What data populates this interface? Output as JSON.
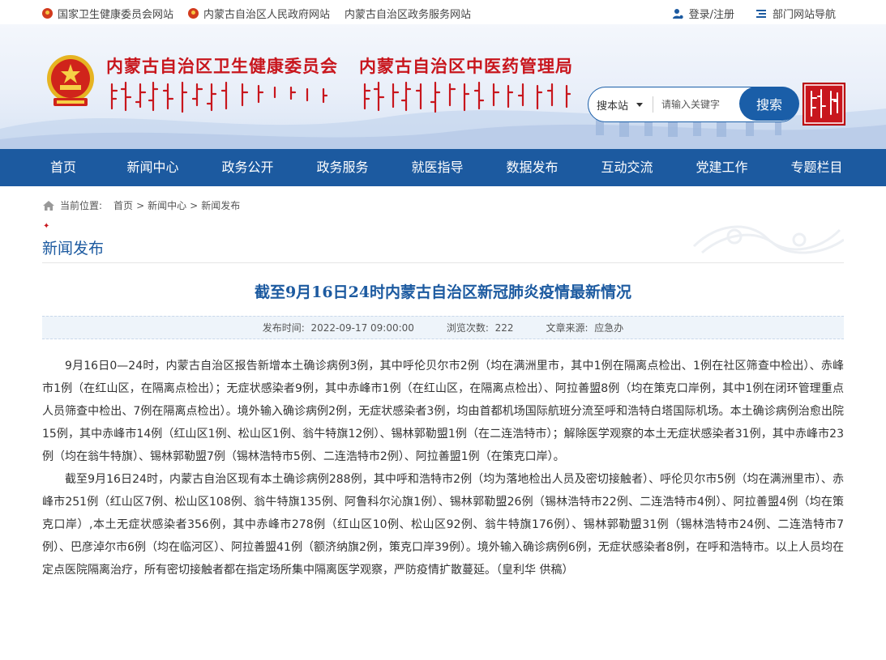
{
  "topbar": {
    "links": [
      "国家卫生健康委员会网站",
      "内蒙古自治区人民政府网站",
      "内蒙古自治区政务服务网站"
    ],
    "login": "登录/注册",
    "nav_guide": "部门网站导航"
  },
  "banner": {
    "title1": "内蒙古自治区卫生健康委员会",
    "title2": "内蒙古自治区中医药管理局",
    "search": {
      "scope": "搜本站",
      "placeholder": "请输入关键字",
      "button": "搜索"
    }
  },
  "nav": [
    "首页",
    "新闻中心",
    "政务公开",
    "政务服务",
    "就医指导",
    "数据发布",
    "互动交流",
    "党建工作",
    "专题栏目"
  ],
  "breadcrumb": {
    "prefix": "当前位置:",
    "items": [
      "首页",
      "新闻中心",
      "新闻发布"
    ],
    "sep": ">"
  },
  "section_title": "新闻发布",
  "article": {
    "title": "截至9月16日24时内蒙古自治区新冠肺炎疫情最新情况",
    "publish_label": "发布时间:",
    "publish_time": "2022-09-17 09:00:00",
    "views_label": "浏览次数:",
    "views": "222",
    "source_label": "文章来源:",
    "source": "应急办",
    "paragraphs": [
      "9月16日0—24时，内蒙古自治区报告新增本土确诊病例3例，其中呼伦贝尔市2例（均在满洲里市，其中1例在隔离点检出、1例在社区筛查中检出）、赤峰市1例（在红山区，在隔离点检出）；无症状感染者9例，其中赤峰市1例（在红山区，在隔离点检出）、阿拉善盟8例（均在策克口岸例，其中1例在闭环管理重点人员筛查中检出、7例在隔离点检出）。境外输入确诊病例2例，无症状感染者3例，均由首都机场国际航班分流至呼和浩特白塔国际机场。本土确诊病例治愈出院15例，其中赤峰市14例（红山区1例、松山区1例、翁牛特旗12例）、锡林郭勒盟1例（在二连浩特市）；解除医学观察的本土无症状感染者31例，其中赤峰市23例（均在翁牛特旗）、锡林郭勒盟7例（锡林浩特市5例、二连浩特市2例）、阿拉善盟1例（在策克口岸）。",
      "截至9月16日24时，内蒙古自治区现有本土确诊病例288例，其中呼和浩特市2例（均为落地检出人员及密切接触者）、呼伦贝尔市5例（均在满洲里市）、赤峰市251例（红山区7例、松山区108例、翁牛特旗135例、阿鲁科尔沁旗1例）、锡林郭勒盟26例（锡林浩特市22例、二连浩特市4例）、阿拉善盟4例（均在策克口岸）,本土无症状感染者356例，其中赤峰市278例（红山区10例、松山区92例、翁牛特旗176例）、锡林郭勒盟31例（锡林浩特市24例、二连浩特市7例）、巴彦淖尔市6例（均在临河区）、阿拉善盟41例（额济纳旗2例，策克口岸39例）。境外输入确诊病例6例，无症状感染者8例，在呼和浩特市。以上人员均在定点医院隔离治疗，所有密切接触者都在指定场所集中隔离医学观察，严防疫情扩散蔓延。（皇利华  供稿）"
    ]
  },
  "colors": {
    "primary_blue": "#1c5aa0",
    "brand_red": "#c8161d"
  }
}
